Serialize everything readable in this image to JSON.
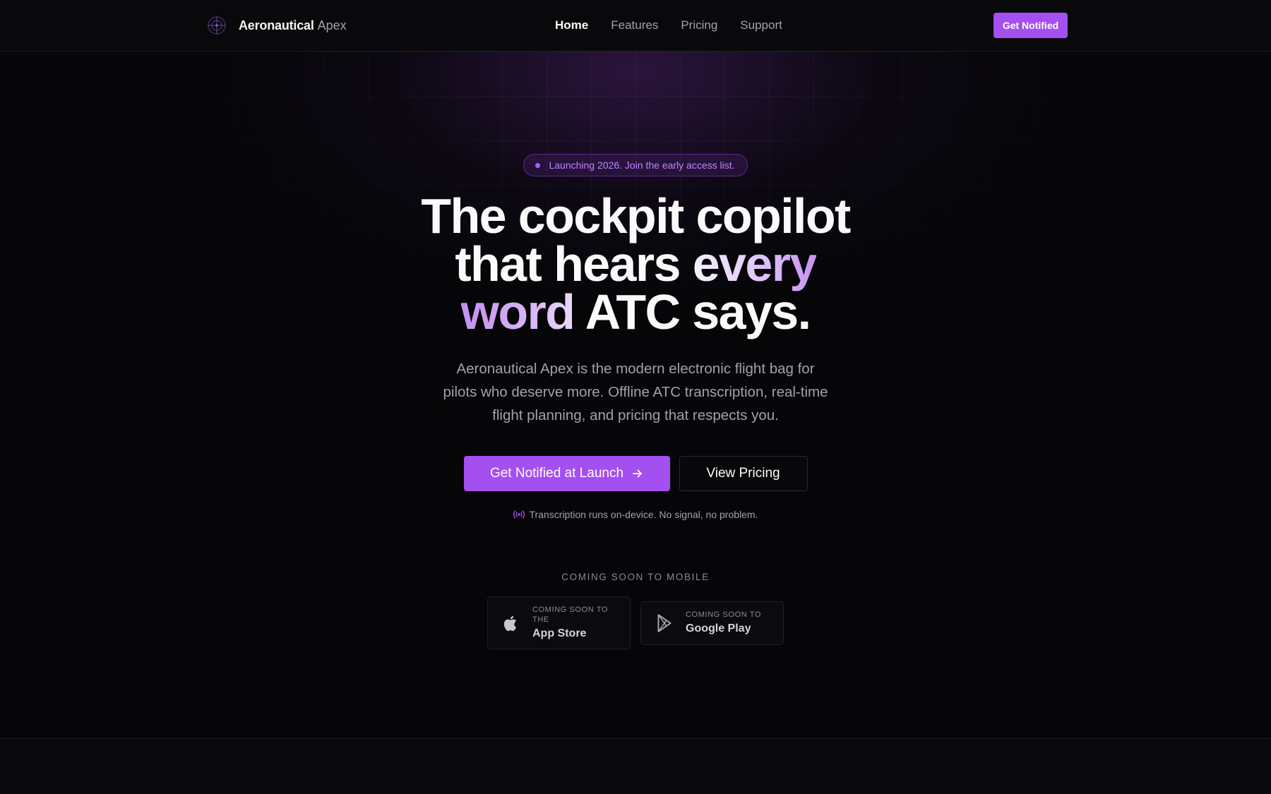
{
  "nav": {
    "brand_name": "Aeronautical",
    "brand_accent": "Apex",
    "links": [
      {
        "label": "Home",
        "active": true
      },
      {
        "label": "Features",
        "active": false
      },
      {
        "label": "Pricing",
        "active": false
      },
      {
        "label": "Support",
        "active": false
      }
    ],
    "cta_label": "Get Notified"
  },
  "hero": {
    "badge": "Launching 2026. Join the early access list.",
    "headline": {
      "line1": "The cockpit copilot",
      "line2_plain": "that hears ",
      "line2_accent": "every",
      "line3_accent": "word",
      "line3_plain": " ATC says."
    },
    "subcopy": "Aeronautical Apex is the modern electronic flight bag for pilots who deserve more. Offline ATC transcription, real-time flight planning, and pricing that respects you.",
    "primary_cta": "Get Notified at Launch",
    "primary_cta_icon": "arrow-right-icon",
    "secondary_cta": "View Pricing",
    "note_icon": "broadcast-icon",
    "note": "Transcription runs on-device. No signal, no problem."
  },
  "mobile": {
    "label": "COMING SOON TO MOBILE",
    "stores": [
      {
        "small": "Coming soon to the",
        "name": "App Store",
        "icon": "apple-icon"
      },
      {
        "small": "Coming soon to",
        "name": "Google Play",
        "icon": "google-play-icon"
      }
    ]
  },
  "colors": {
    "accent": "#a44ff0",
    "background": "#060608",
    "badge_text": "#c084fc"
  }
}
